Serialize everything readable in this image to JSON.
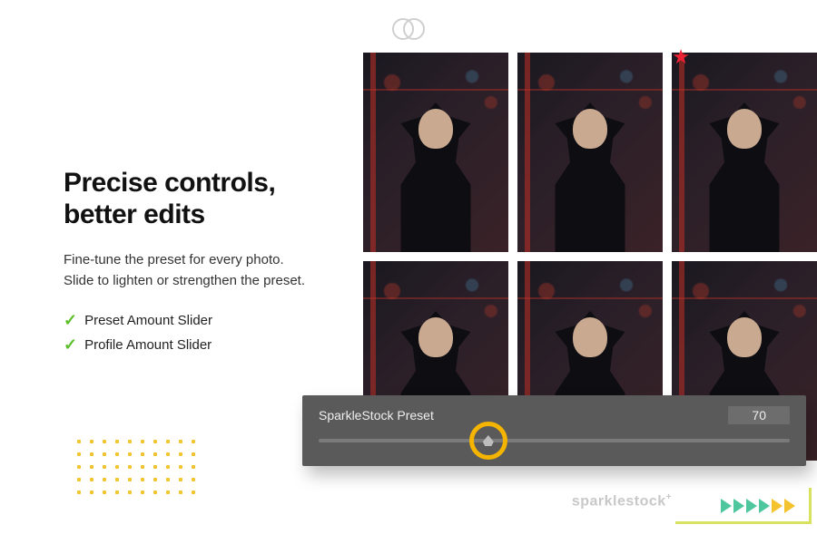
{
  "headline_line1": "Precise controls,",
  "headline_line2": "better edits",
  "subtext": "Fine-tune the preset for every photo. Slide to lighten or strengthen the preset.",
  "features": [
    "Preset Amount Slider",
    "Profile Amount Slider"
  ],
  "slider": {
    "label": "SparkleStock Preset",
    "value": "70"
  },
  "watermark": "sparklestock",
  "watermark_mark": "+"
}
